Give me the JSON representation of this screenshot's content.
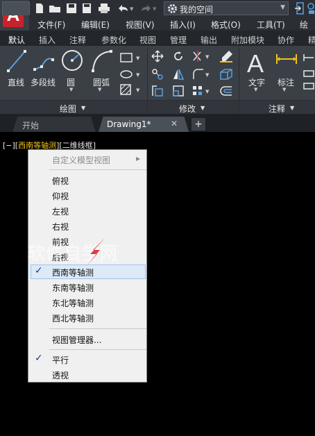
{
  "title_bar": {
    "workspace": "我的空间"
  },
  "menu": {
    "items": [
      "文件(F)",
      "编辑(E)",
      "视图(V)",
      "插入(I)",
      "格式(O)",
      "工具(T)",
      "绘图"
    ]
  },
  "ribbon_tabs": [
    "默认",
    "插入",
    "注释",
    "参数化",
    "视图",
    "管理",
    "输出",
    "附加模块",
    "协作",
    "精"
  ],
  "ribbon": {
    "draw": {
      "line": "直线",
      "polyline": "多段线",
      "circle": "圆",
      "arc": "圆弧",
      "panel_title": "绘图"
    },
    "modify": {
      "panel_title": "修改"
    },
    "annotation": {
      "text": "文字",
      "dimension": "标注",
      "panel_title": "注释"
    }
  },
  "doc_tabs": {
    "start": "开始",
    "drawing": "Drawing1*",
    "new_tab": "+"
  },
  "viewport": {
    "open": "[−][",
    "view": "西南等轴测",
    "mid": "][",
    "style": "二维线框",
    "close": "]"
  },
  "context_menu": {
    "custom_views": "自定义模型视图",
    "views": [
      "俯视",
      "仰视",
      "左视",
      "右视",
      "前视",
      "后视",
      "西南等轴测",
      "东南等轴测",
      "东北等轴测",
      "西北等轴测"
    ],
    "view_manager": "视图管理器...",
    "parallel": "平行",
    "perspective": "透视",
    "checked": [
      "西南等轴测",
      "平行"
    ]
  },
  "watermark": {
    "text": "软件自学网",
    "sub": "WWW.RJZXW.COM"
  },
  "colors": {
    "accent_yellow": "#f2c21b",
    "logo_red": "#c8232c",
    "check_blue": "#1c3a8a",
    "highlight": "#dce9f7"
  }
}
